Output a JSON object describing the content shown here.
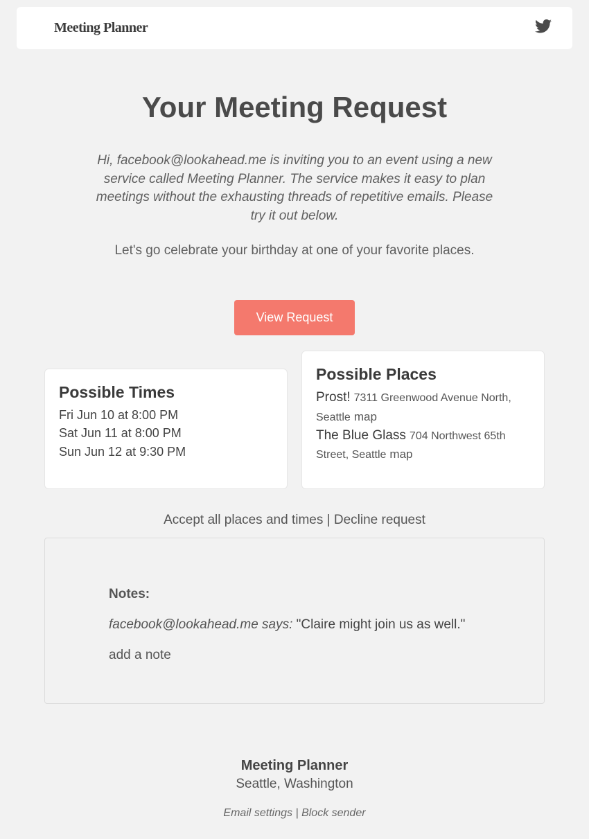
{
  "header": {
    "brand": "Meeting Planner"
  },
  "title": "Your Meeting Request",
  "intro": {
    "hi": "Hi, ",
    "email": "facebook@lookahead.me",
    "mid1": " is inviting you to an event using a new service called ",
    "service": "Meeting Planner",
    "mid2": ". The service makes it easy to plan meetings without the exhausting threads of repetitive emails. Please try it out below."
  },
  "lead": "Let's go celebrate your birthday at one of your favorite places.",
  "button": "View Request",
  "times": {
    "heading": "Possible Times",
    "items": [
      "Fri Jun 10 at 8:00 PM",
      "Sat Jun 11 at 8:00 PM",
      "Sun Jun 12 at 9:30 PM"
    ]
  },
  "places": {
    "heading": "Possible Places",
    "items": [
      {
        "name": "Prost!",
        "address": "7311 Greenwood Avenue North, Seattle",
        "map": "map"
      },
      {
        "name": "The Blue Glass",
        "address": "704 Northwest 65th Street, Seattle",
        "map": "map"
      }
    ]
  },
  "actions": {
    "accept": "Accept all places and times",
    "sep": " | ",
    "decline": "Decline request"
  },
  "notes": {
    "heading": "Notes:",
    "author": "facebook@lookahead.me",
    "says": " says: ",
    "quote": "\"Claire might join us as well.\"",
    "add": "add a note"
  },
  "footer": {
    "brand": "Meeting Planner",
    "location": "Seattle, Washington",
    "email_settings": "Email settings",
    "sep": " | ",
    "block": "Block sender"
  }
}
